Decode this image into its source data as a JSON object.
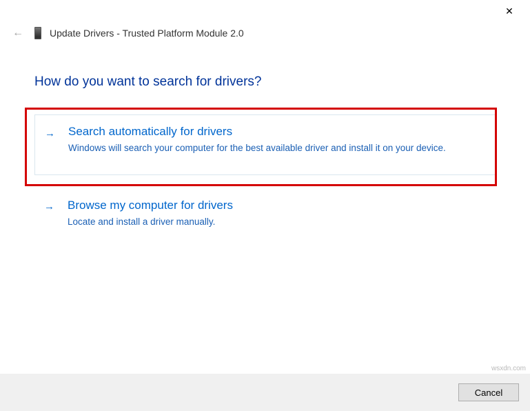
{
  "titlebar": {
    "close_glyph": "✕"
  },
  "header": {
    "back_glyph": "←",
    "title": "Update Drivers - Trusted Platform Module 2.0"
  },
  "question": "How do you want to search for drivers?",
  "options": {
    "auto": {
      "arrow": "→",
      "title": "Search automatically for drivers",
      "desc": "Windows will search your computer for the best available driver and install it on your device."
    },
    "browse": {
      "arrow": "→",
      "title": "Browse my computer for drivers",
      "desc": "Locate and install a driver manually."
    }
  },
  "footer": {
    "cancel_label": "Cancel"
  },
  "watermark": "wsxdn.com"
}
